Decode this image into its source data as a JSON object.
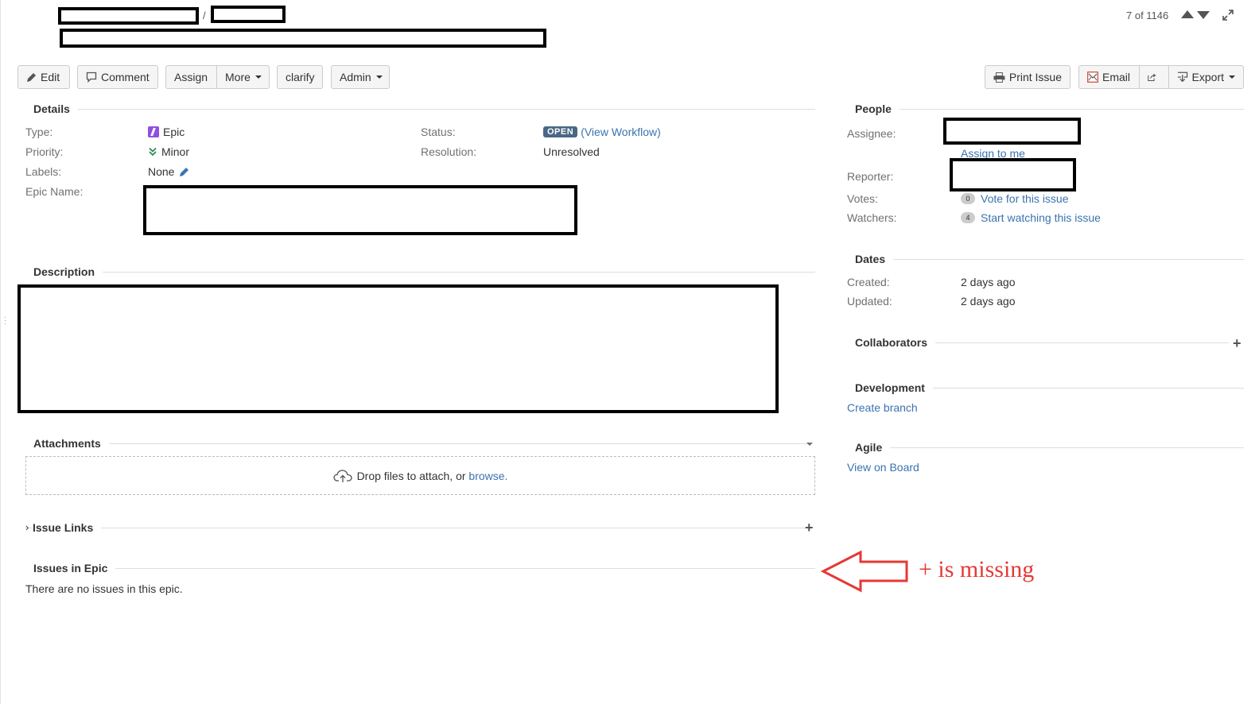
{
  "header": {
    "breadcrumb_separator": "/",
    "pager": {
      "text": "7 of 1146"
    }
  },
  "toolbar": {
    "edit": "Edit",
    "comment": "Comment",
    "assign": "Assign",
    "more": "More",
    "clarify": "clarify",
    "admin": "Admin",
    "print": "Print Issue",
    "email": "Email",
    "export": "Export"
  },
  "details": {
    "title": "Details",
    "type_label": "Type:",
    "type_value": "Epic",
    "priority_label": "Priority:",
    "priority_value": "Minor",
    "labels_label": "Labels:",
    "labels_value": "None",
    "epic_name_label": "Epic Name:",
    "status_label": "Status:",
    "status_value": "OPEN",
    "view_workflow": "(View Workflow)",
    "resolution_label": "Resolution:",
    "resolution_value": "Unresolved"
  },
  "description": {
    "title": "Description"
  },
  "attachments": {
    "title": "Attachments",
    "drop_text": "Drop files to attach, or",
    "browse": "browse."
  },
  "issue_links": {
    "title": "Issue Links"
  },
  "issues_in_epic": {
    "title": "Issues in Epic",
    "empty_text": "There are no issues in this epic."
  },
  "people": {
    "title": "People",
    "assignee_label": "Assignee:",
    "assign_to_me": "Assign to me",
    "reporter_label": "Reporter:",
    "votes_label": "Votes:",
    "votes_count": "0",
    "vote_link": "Vote for this issue",
    "watchers_label": "Watchers:",
    "watchers_count": "4",
    "watch_link": "Start watching this issue"
  },
  "dates": {
    "title": "Dates",
    "created_label": "Created:",
    "created_value": "2 days ago",
    "updated_label": "Updated:",
    "updated_value": "2 days ago"
  },
  "collaborators": {
    "title": "Collaborators"
  },
  "development": {
    "title": "Development",
    "create_branch": "Create branch"
  },
  "agile": {
    "title": "Agile",
    "view_on_board": "View on Board"
  },
  "annotation": {
    "text": "+ is missing",
    "color": "#e53935"
  },
  "colors": {
    "link": "#3b73af",
    "status_lozenge": "#4a6785",
    "epic_purple": "#904ee2",
    "priority_green": "#2e8b57"
  }
}
